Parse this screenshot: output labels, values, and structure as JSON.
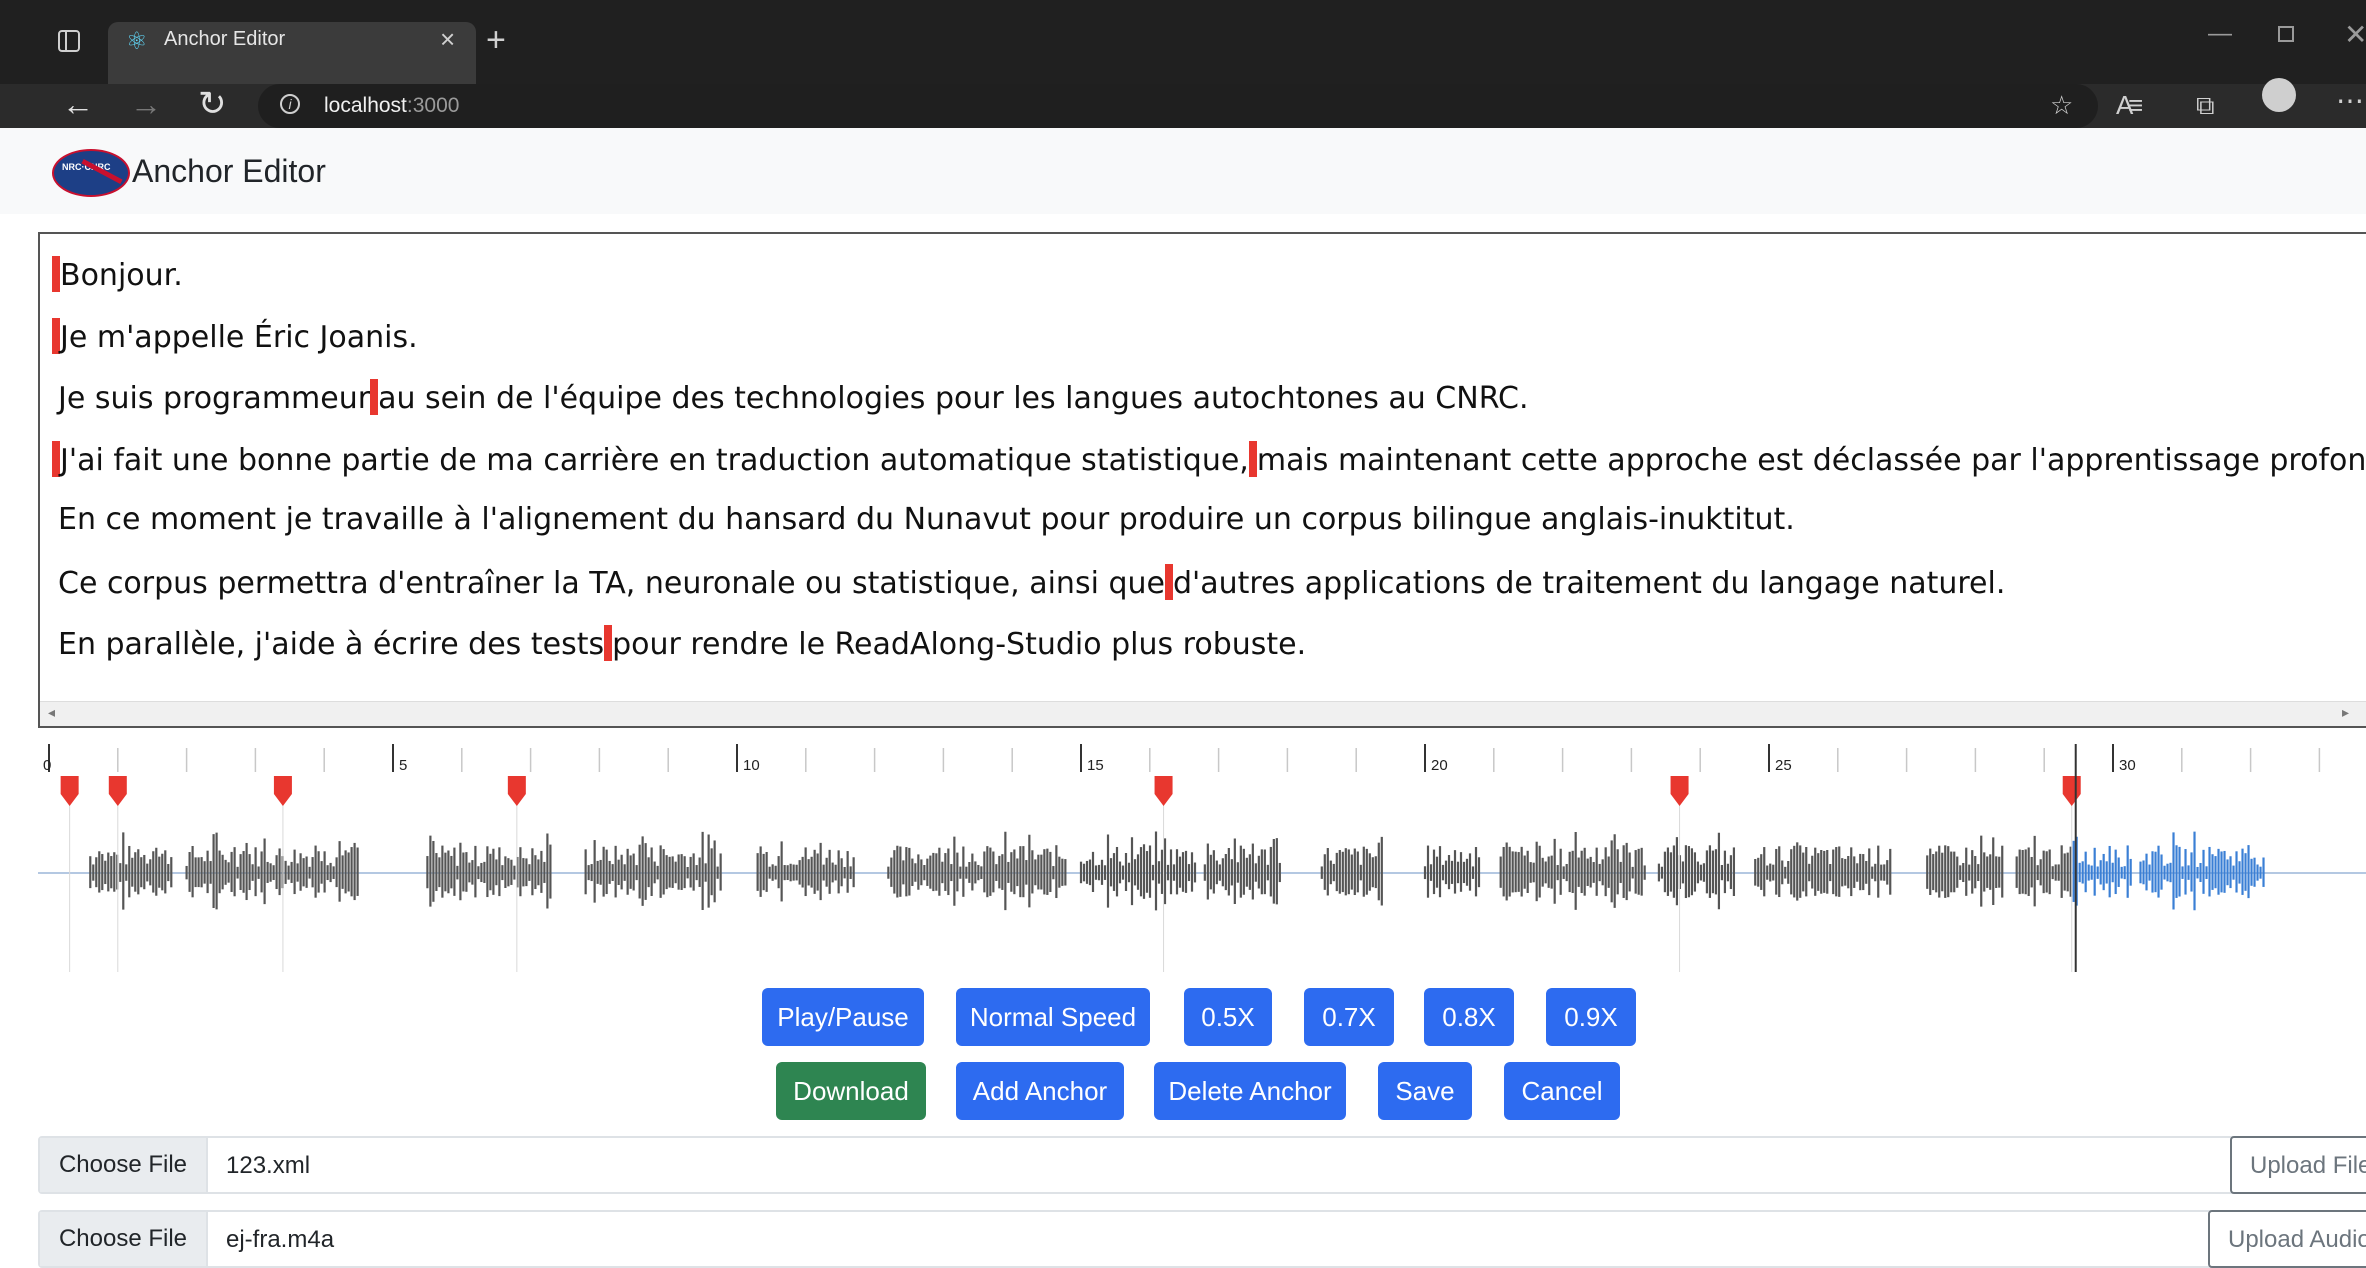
{
  "browser": {
    "tab_title": "Anchor Editor",
    "url_host": "localhost",
    "url_port": ":3000"
  },
  "app": {
    "title": "Anchor Editor",
    "logo_text": "NRC·CNRC Canada"
  },
  "text_lines": [
    {
      "segments": [
        "Bonjour."
      ]
    },
    {
      "segments": [
        "Je m'appelle Éric Joanis."
      ]
    },
    {
      "segments": [
        "Je suis programmeur",
        "au sein de l'équipe des technologies pour les langues autochtones au CNRC."
      ]
    },
    {
      "segments": [
        "J'ai fait une bonne partie de ma carrière en traduction automatique statistique,",
        "mais maintenant cette approche est déclassée par l'apprentissage profond."
      ]
    },
    {
      "segments": [
        "En ce moment je travaille à l'alignement du hansard du Nunavut pour produire un corpus bilingue anglais-inuktitut."
      ]
    },
    {
      "segments": [
        "Ce corpus permettra d'entraîner la TA, neuronale ou statistique, ainsi que",
        "d'autres applications de traitement du langage naturel."
      ]
    },
    {
      "segments": [
        "En parallèle, j'aide à écrire des tests",
        "pour rendre le ReadAlong-Studio plus robuste."
      ]
    }
  ],
  "timeline": {
    "tick_labels": [
      "0",
      "5",
      "10",
      "15",
      "20",
      "25",
      "30"
    ],
    "anchors_seconds": [
      0.3,
      1.0,
      3.4,
      6.8,
      16.2,
      23.7,
      29.4
    ],
    "playhead_seconds": 29.4,
    "played_color": "#555555",
    "unplayed_color": "#3a7fd5",
    "anchor_color": "#e8372f"
  },
  "controls": {
    "play_pause": "Play/Pause",
    "normal_speed": "Normal Speed",
    "speed_05": "0.5X",
    "speed_07": "0.7X",
    "speed_08": "0.8X",
    "speed_09": "0.9X",
    "download": "Download",
    "add_anchor": "Add Anchor",
    "delete_anchor": "Delete Anchor",
    "save": "Save",
    "cancel": "Cancel"
  },
  "files": {
    "xml": {
      "choose_label": "Choose File",
      "file_name": "123.xml",
      "upload_label": "Upload File"
    },
    "audio": {
      "choose_label": "Choose File",
      "file_name": "ej-fra.m4a",
      "upload_label": "Upload Audio"
    }
  }
}
